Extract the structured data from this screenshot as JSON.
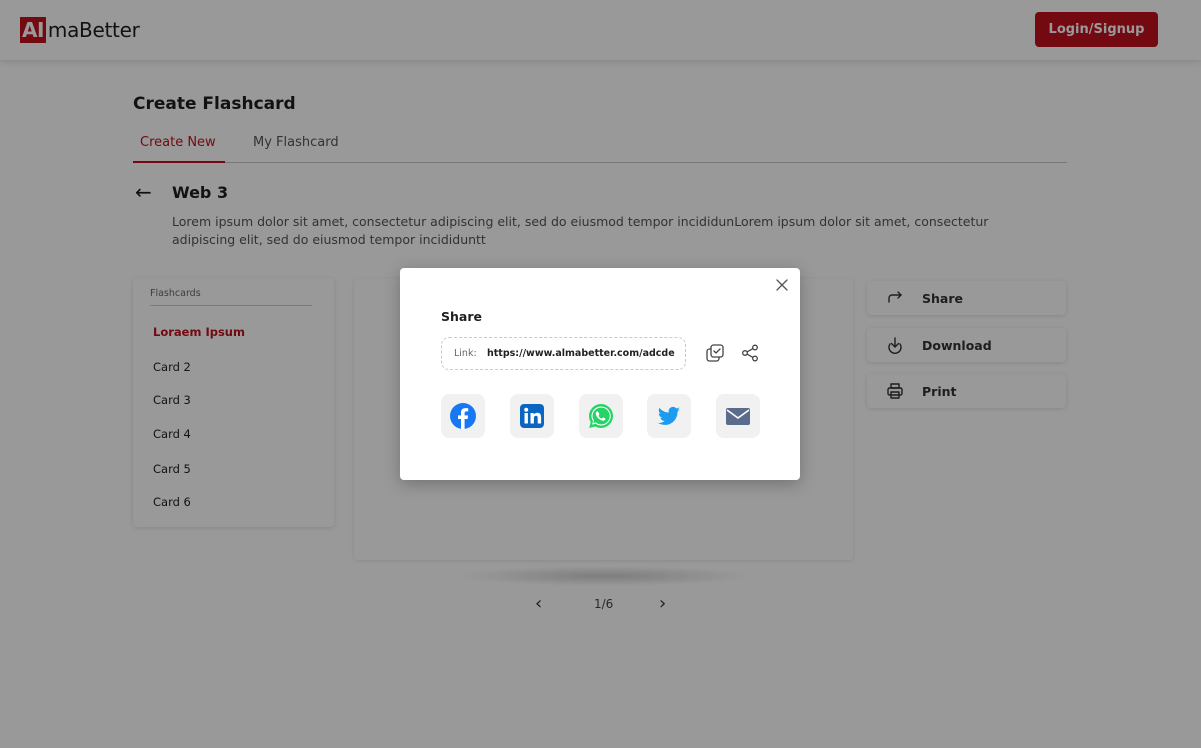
{
  "header": {
    "logo_ai": "AI",
    "logo_rest": "maBetter",
    "login_label": "Login/Signup"
  },
  "page": {
    "title": "Create Flashcard",
    "tabs": [
      {
        "label": "Create New",
        "active": true
      },
      {
        "label": "My Flashcard",
        "active": false
      }
    ],
    "deck_title": "Web 3",
    "deck_description": "Lorem ipsum dolor sit amet, consectetur adipiscing elit, sed do eiusmod tempor incididunLorem ipsum dolor sit amet, consectetur adipiscing elit, sed do eiusmod tempor incididuntt"
  },
  "sidebar": {
    "heading": "Flashcards",
    "items": [
      {
        "label": "Loraem Ipsum",
        "active": true
      },
      {
        "label": "Card 2",
        "active": false
      },
      {
        "label": "Card 3",
        "active": false
      },
      {
        "label": "Card 4",
        "active": false
      },
      {
        "label": "Card 5",
        "active": false
      },
      {
        "label": "Card 6",
        "active": false
      }
    ]
  },
  "pagination": {
    "text": "1/6",
    "prev_icon": "chevron-left-icon",
    "next_icon": "chevron-right-icon"
  },
  "actions": [
    {
      "label": "Share",
      "icon": "share-arrow-icon"
    },
    {
      "label": "Download",
      "icon": "download-icon"
    },
    {
      "label": "Print",
      "icon": "printer-icon"
    }
  ],
  "modal": {
    "title": "Share",
    "link_label": "Link:",
    "link_value": "https://www.almabetter.com/adcde",
    "socials": [
      {
        "name": "facebook",
        "icon": "facebook-icon"
      },
      {
        "name": "linkedin",
        "icon": "linkedin-icon"
      },
      {
        "name": "whatsapp",
        "icon": "whatsapp-icon"
      },
      {
        "name": "twitter",
        "icon": "twitter-icon"
      },
      {
        "name": "email",
        "icon": "mail-icon"
      }
    ]
  },
  "colors": {
    "brand": "#c2111d",
    "overlay": "rgba(0,0,0,0.40)",
    "facebook": "#1877f2",
    "linkedin": "#0a66c2",
    "whatsapp": "#25d366",
    "twitter": "#1d9bf0",
    "mail": "#5b6b8c"
  }
}
